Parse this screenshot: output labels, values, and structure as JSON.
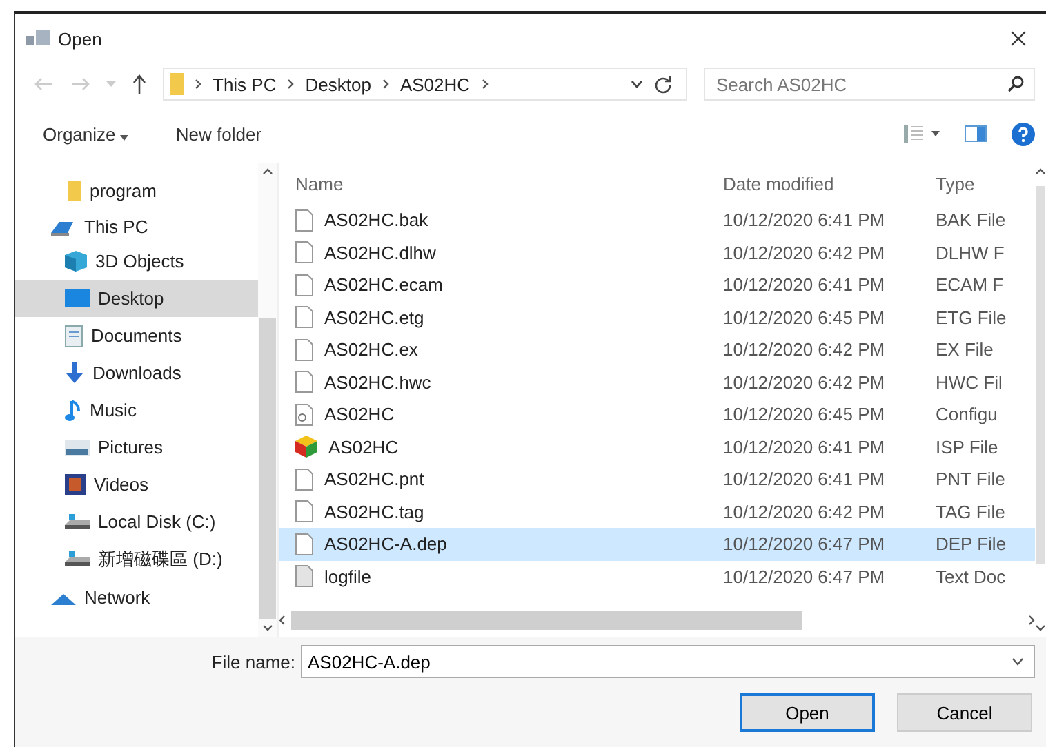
{
  "window": {
    "title": "Open"
  },
  "address": {
    "crumbs": [
      "This PC",
      "Desktop",
      "AS02HC"
    ]
  },
  "search": {
    "placeholder": "Search AS02HC"
  },
  "toolbar": {
    "organize": "Organize",
    "new_folder": "New folder"
  },
  "sidebar": {
    "items": [
      {
        "label": "program",
        "kind": "folder",
        "selected": false
      },
      {
        "label": "This PC",
        "kind": "pc",
        "selected": false,
        "children": [
          {
            "label": "3D Objects",
            "kind": "cube",
            "selected": false
          },
          {
            "label": "Desktop",
            "kind": "desktop",
            "selected": true
          },
          {
            "label": "Documents",
            "kind": "docs",
            "selected": false
          },
          {
            "label": "Downloads",
            "kind": "download",
            "selected": false
          },
          {
            "label": "Music",
            "kind": "music",
            "selected": false
          },
          {
            "label": "Pictures",
            "kind": "pictures",
            "selected": false
          },
          {
            "label": "Videos",
            "kind": "videos",
            "selected": false
          },
          {
            "label": "Local Disk (C:)",
            "kind": "disk",
            "selected": false
          },
          {
            "label": "新增磁碟區 (D:)",
            "kind": "disk",
            "selected": false
          }
        ]
      },
      {
        "label": "Network",
        "kind": "network",
        "selected": false
      }
    ]
  },
  "table": {
    "columns": [
      "Name",
      "Date modified",
      "Type"
    ],
    "rows": [
      {
        "kind": "blank",
        "name": "AS02HC.bak",
        "date": "10/12/2020 6:41 PM",
        "type": "BAK File",
        "selected": false
      },
      {
        "kind": "blank",
        "name": "AS02HC.dlhw",
        "date": "10/12/2020 6:42 PM",
        "type": "DLHW F",
        "selected": false
      },
      {
        "kind": "blank",
        "name": "AS02HC.ecam",
        "date": "10/12/2020 6:41 PM",
        "type": "ECAM F",
        "selected": false
      },
      {
        "kind": "blank",
        "name": "AS02HC.etg",
        "date": "10/12/2020 6:45 PM",
        "type": "ETG File",
        "selected": false
      },
      {
        "kind": "blank",
        "name": "AS02HC.ex",
        "date": "10/12/2020 6:42 PM",
        "type": "EX File",
        "selected": false
      },
      {
        "kind": "blank",
        "name": "AS02HC.hwc",
        "date": "10/12/2020 6:42 PM",
        "type": "HWC Fil",
        "selected": false
      },
      {
        "kind": "config",
        "name": "AS02HC",
        "date": "10/12/2020 6:45 PM",
        "type": "Configu",
        "selected": false
      },
      {
        "kind": "isp",
        "name": "AS02HC",
        "date": "10/12/2020 6:41 PM",
        "type": "ISP File",
        "selected": false
      },
      {
        "kind": "blank",
        "name": "AS02HC.pnt",
        "date": "10/12/2020 6:41 PM",
        "type": "PNT File",
        "selected": false
      },
      {
        "kind": "blank",
        "name": "AS02HC.tag",
        "date": "10/12/2020 6:42 PM",
        "type": "TAG File",
        "selected": false
      },
      {
        "kind": "blank",
        "name": "AS02HC-A.dep",
        "date": "10/12/2020 6:47 PM",
        "type": "DEP File",
        "selected": true
      },
      {
        "kind": "text",
        "name": "logfile",
        "date": "10/12/2020 6:47 PM",
        "type": "Text Doc",
        "selected": false
      }
    ]
  },
  "file_name": {
    "label": "File name:",
    "value": "AS02HC-A.dep"
  },
  "buttons": [
    {
      "label": "Open",
      "kind": "primary"
    },
    {
      "label": "Cancel",
      "kind": "normal"
    }
  ]
}
